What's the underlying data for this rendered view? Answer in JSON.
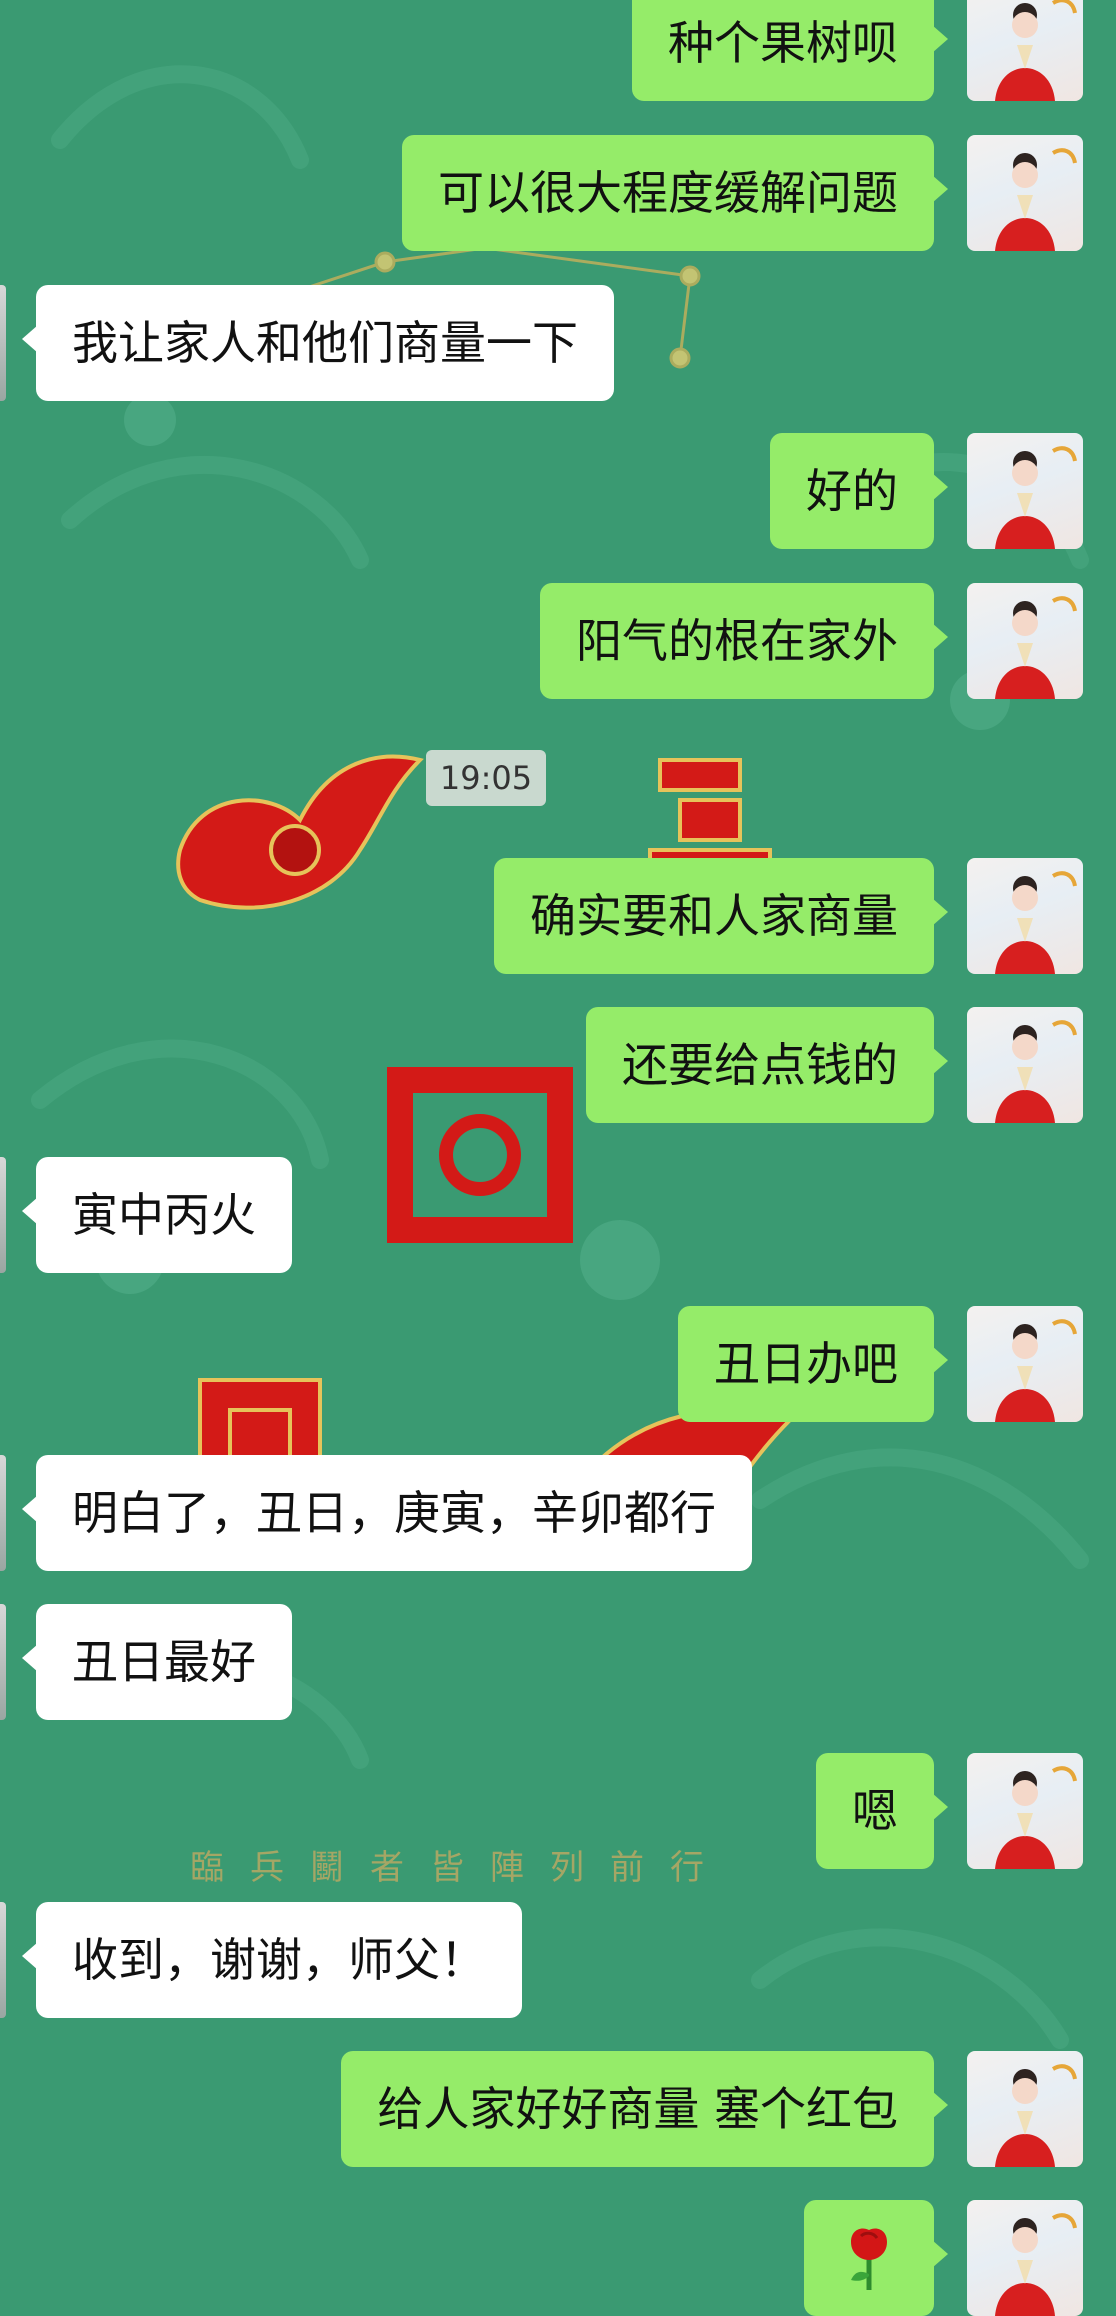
{
  "timestamp": "19:05",
  "footer_text": "臨兵鬭者皆陣列前行",
  "messages": [
    {
      "side": "out",
      "text": "种个果树呗"
    },
    {
      "side": "out",
      "text": "可以很大程度缓解问题"
    },
    {
      "side": "in",
      "text": "我让家人和他们商量一下"
    },
    {
      "side": "out",
      "text": "好的"
    },
    {
      "side": "out",
      "text": "阳气的根在家外"
    },
    {
      "side": "out",
      "text": "确实要和人家商量"
    },
    {
      "side": "out",
      "text": "还要给点钱的"
    },
    {
      "side": "in",
      "text": "寅中丙火"
    },
    {
      "side": "out",
      "text": "丑日办吧"
    },
    {
      "side": "in",
      "text": "明白了，丑日，庚寅，辛卯都行"
    },
    {
      "side": "in",
      "text": "丑日最好"
    },
    {
      "side": "out",
      "text": "嗯"
    },
    {
      "side": "in",
      "text": "收到，谢谢，师父！"
    },
    {
      "side": "out",
      "text": "给人家好好商量 塞个红包"
    },
    {
      "side": "out",
      "text": "",
      "icon": "rose-emoji-icon"
    }
  ],
  "colors": {
    "background": "#3a9a72",
    "outgoing_bubble": "#95ec69",
    "incoming_bubble": "#ffffff",
    "emblem_red": "#d31a17",
    "gold": "#d9b64f"
  }
}
